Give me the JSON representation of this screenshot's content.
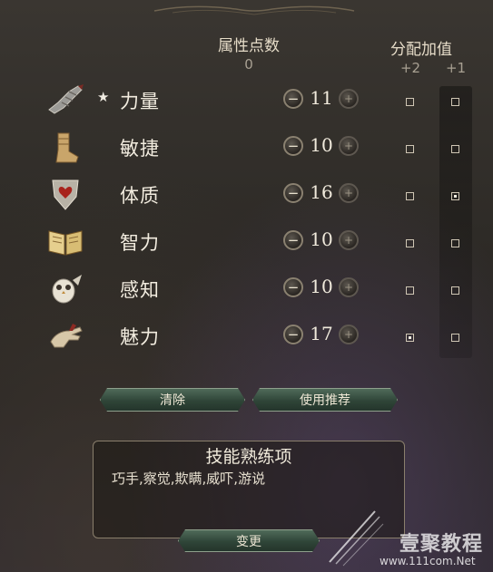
{
  "header": {
    "ability_points_label": "属性点数",
    "ability_points_value": "0",
    "assign_bonus_label": "分配加值",
    "bonus_plus2": "+2",
    "bonus_plus1": "+1"
  },
  "attributes": [
    {
      "name": "力量",
      "value": "11",
      "starred": true,
      "plus2": false,
      "plus1": false,
      "icon": "gauntlet-icon"
    },
    {
      "name": "敏捷",
      "value": "10",
      "starred": false,
      "plus2": false,
      "plus1": false,
      "icon": "boot-icon"
    },
    {
      "name": "体质",
      "value": "16",
      "starred": false,
      "plus2": false,
      "plus1": true,
      "icon": "heart-shield-icon"
    },
    {
      "name": "智力",
      "value": "10",
      "starred": false,
      "plus2": false,
      "plus1": false,
      "icon": "open-book-icon"
    },
    {
      "name": "感知",
      "value": "10",
      "starred": false,
      "plus2": false,
      "plus1": false,
      "icon": "owl-icon"
    },
    {
      "name": "魅力",
      "value": "17",
      "starred": false,
      "plus2": true,
      "plus1": false,
      "icon": "hand-icon"
    }
  ],
  "stepper": {
    "minus": "−",
    "plus": "+"
  },
  "star_glyph": "★",
  "buttons": {
    "clear_label": "清除",
    "recommended_label": "使用推荐",
    "change_label": "变更"
  },
  "skills": {
    "title": "技能熟练项",
    "list": "巧手,察觉,欺瞒,威吓,游说"
  },
  "watermark": {
    "text": "壹聚教程",
    "url": "www.111com.Net"
  }
}
